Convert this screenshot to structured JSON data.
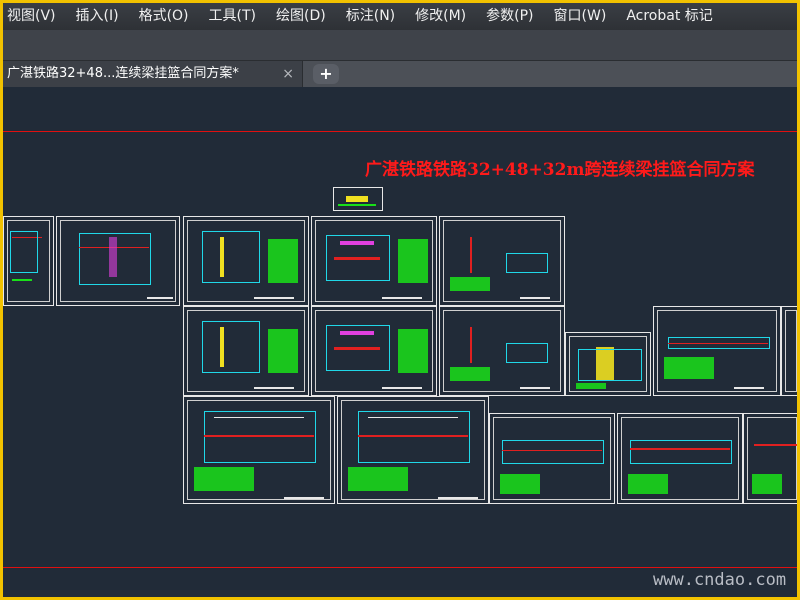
{
  "menubar": {
    "items": [
      "视图(V)",
      "插入(I)",
      "格式(O)",
      "工具(T)",
      "绘图(D)",
      "标注(N)",
      "修改(M)",
      "参数(P)",
      "窗口(W)",
      "Acrobat 标记"
    ]
  },
  "tabs": {
    "active_label": "广湛铁路32+48...连续梁挂篮合同方案*",
    "close_icon": "×",
    "add_icon": "+"
  },
  "drawing": {
    "title": "广湛铁路铁路32+48+32m跨连续梁挂篮合同方案"
  },
  "watermark": "www.cndao.com",
  "colors": {
    "frame": "#f2c200",
    "canvas": "#212b38",
    "title": "#ff1a1a"
  }
}
